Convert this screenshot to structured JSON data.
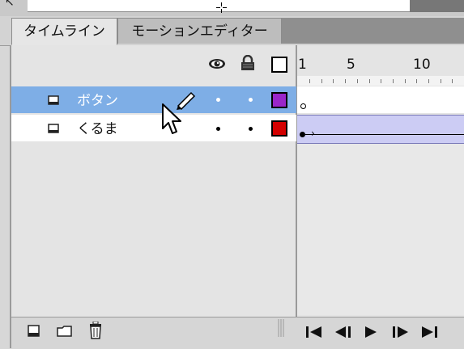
{
  "tabs": [
    {
      "label": "タイムライン",
      "active": true
    },
    {
      "label": "モーションエディター",
      "active": false
    }
  ],
  "header": {
    "icons": [
      "eye-icon",
      "lock-icon",
      "outline-icon"
    ],
    "frame_numbers": [
      "1",
      "5",
      "10"
    ]
  },
  "layers": [
    {
      "name": "ボタン",
      "selected": true,
      "color": "#9a26c9",
      "editing": true
    },
    {
      "name": "くるま",
      "selected": false,
      "color": "#d40000",
      "editing": false
    }
  ],
  "bottom_icons": [
    "new-layer-icon",
    "new-folder-icon",
    "delete-layer-icon"
  ],
  "playback_icons": [
    "go-to-first-frame-icon",
    "step-back-icon",
    "play-icon",
    "step-forward-icon",
    "go-to-last-frame-icon"
  ],
  "colors": {
    "selection": "#7eaee6",
    "tween": "#ccccf4"
  }
}
